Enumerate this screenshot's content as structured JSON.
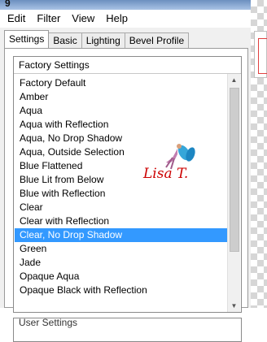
{
  "menu": [
    {
      "label": "Edit"
    },
    {
      "label": "Filter"
    },
    {
      "label": "View"
    },
    {
      "label": "Help"
    }
  ],
  "tabs": [
    {
      "label": "Settings",
      "active": true
    },
    {
      "label": "Basic"
    },
    {
      "label": "Lighting"
    },
    {
      "label": "Bevel Profile"
    }
  ],
  "presets": {
    "header": "Factory Settings",
    "selected": "Clear, No Drop Shadow",
    "items": [
      "Factory Default",
      "Amber",
      "Aqua",
      "Aqua with Reflection",
      "Aqua, No Drop Shadow",
      "Aqua, Outside Selection",
      "Blue Flattened",
      "Blue Lit from Below",
      "Blue with Reflection",
      "Clear",
      "Clear with Reflection",
      "Clear, No Drop Shadow",
      "Green",
      "Jade",
      "Opaque Aqua",
      "Opaque Black with Reflection"
    ]
  },
  "user_settings": {
    "label": "User Settings"
  },
  "watermark": {
    "text": "Lisa T."
  },
  "colors": {
    "selection": "#3399ff",
    "watermark": "#cc0000"
  }
}
